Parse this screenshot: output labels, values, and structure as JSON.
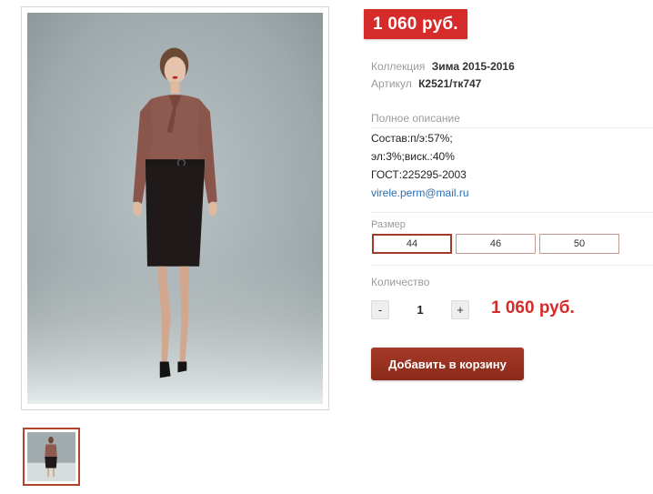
{
  "product": {
    "price_badge": "1 060 руб.",
    "collection_label": "Коллекция",
    "collection_value": "Зима 2015-2016",
    "article_label": "Артикул",
    "article_value": "К2521/тк747",
    "description_title": "Полное описание",
    "description_lines": [
      "Состав:п/э:57%;",
      "эл:3%;виск.:40%",
      "ГОСТ:225295-2003"
    ],
    "email": "virele.perm@mail.ru",
    "size_label": "Размер",
    "sizes": [
      "44",
      "46",
      "50"
    ],
    "selected_size": "44",
    "quantity_label": "Количество",
    "qty_minus": "-",
    "qty_plus": "+",
    "quantity": "1",
    "total_price": "1 060 руб.",
    "add_to_cart": "Добавить в корзину"
  },
  "images": {
    "main_photo": "model-photo",
    "thumbnail": "model-photo-thumb"
  },
  "colors": {
    "price_red": "#d62b2b",
    "button_brown": "#8a2a1a",
    "size_active_border": "#a33a2a",
    "link_blue": "#2a6db0"
  }
}
